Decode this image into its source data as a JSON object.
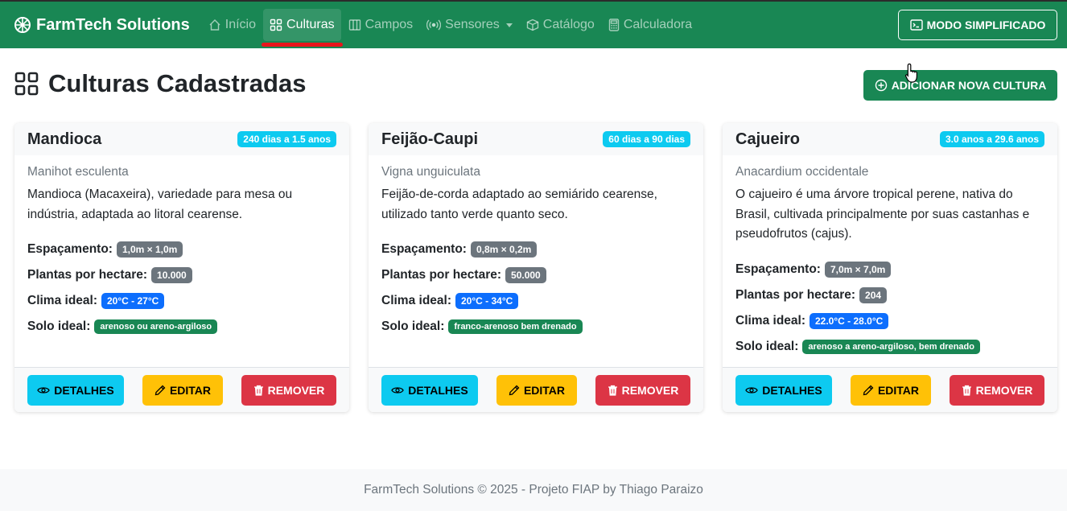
{
  "navbar": {
    "brand": "FarmTech Solutions",
    "brand_icon": "flower-icon",
    "items": [
      {
        "label": "Início",
        "icon": "house-icon"
      },
      {
        "label": "Culturas",
        "icon": "grid-icon",
        "active": true
      },
      {
        "label": "Campos",
        "icon": "columns-icon"
      },
      {
        "label": "Sensores",
        "icon": "broadcast-icon",
        "dropdown": true
      },
      {
        "label": "Catálogo",
        "icon": "box-icon"
      },
      {
        "label": "Calculadora",
        "icon": "calculator-icon"
      }
    ],
    "simple_mode_label": "MODO SIMPLIFICADO"
  },
  "page": {
    "title": "Culturas Cadastradas",
    "add_button": "ADICIONAR NOVA CULTURA"
  },
  "labels": {
    "spacing": "Espaçamento:",
    "plants": "Plantas por hectare:",
    "climate": "Clima ideal:",
    "soil": "Solo ideal:",
    "details": "DETALHES",
    "edit": "EDITAR",
    "remove": "REMOVER"
  },
  "cultures": [
    {
      "name": "Mandioca",
      "cycle": "240 dias a 1.5 anos",
      "scientific": "Manihot esculenta",
      "description": "Mandioca (Macaxeira), variedade para mesa ou indústria, adaptada ao litoral cearense.",
      "spacing": "1,0m × 1,0m",
      "plants": "10.000",
      "climate": "20°C - 27°C",
      "soil": "arenoso ou areno-argiloso"
    },
    {
      "name": "Feijão-Caupi",
      "cycle": "60 dias a 90 dias",
      "scientific": "Vigna unguiculata",
      "description": "Feijão-de-corda adaptado ao semiárido cearense, utilizado tanto verde quanto seco.",
      "spacing": "0,8m × 0,2m",
      "plants": "50.000",
      "climate": "20°C - 34°C",
      "soil": "franco-arenoso bem drenado"
    },
    {
      "name": "Cajueiro",
      "cycle": "3.0 anos a 29.6 anos",
      "scientific": "Anacardium occidentale",
      "description": "O cajueiro é uma árvore tropical perene, nativa do Brasil, cultivada principalmente por suas castanhas e pseudofrutos (cajus).",
      "spacing": "7,0m × 7,0m",
      "plants": "204",
      "climate": "22.0°C - 28.0°C",
      "soil": "arenoso a areno-argiloso, bem drenado"
    }
  ],
  "footer": "FarmTech Solutions © 2025 - Projeto FIAP by Thiago Paraizo"
}
